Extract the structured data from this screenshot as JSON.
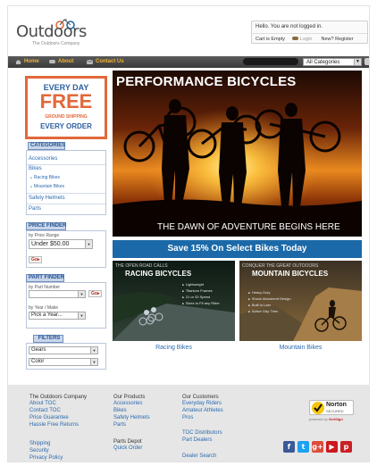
{
  "header": {
    "logo_text": "Outdoors",
    "logo_sub": "The Outdoors Company",
    "account_status": "Hello. You are not logged in.",
    "cart_status": "Cart is Empty",
    "login_label": "Login",
    "register_label": "New? Register"
  },
  "nav": {
    "home": "Home",
    "about": "About",
    "contact": "Contact Us",
    "category_select": "All Categories"
  },
  "promo": {
    "line1": "EVERY DAY",
    "line2": "FREE",
    "line3": "GROUND SHIPPING",
    "line4": "EVERY ORDER"
  },
  "categories": {
    "heading": "CATEGORIES",
    "items": [
      "Accessories",
      "Bikes",
      "Racing Bikes",
      "Mountain Bikes",
      "Safety Helmets",
      "Parts"
    ]
  },
  "price_finder": {
    "heading": "PRICE FINDER",
    "label": "by Price Range",
    "value": "Under $50.00",
    "go": "Go"
  },
  "part_finder": {
    "heading": "PART FINDER",
    "part_label": "by Part Number",
    "part_go": "Go",
    "year_label": "by Year / Make",
    "year_value": "Pick a Year..."
  },
  "filters": {
    "heading": "FILTERS",
    "gears": "Gears",
    "color": "Color"
  },
  "hero": {
    "title": "PERFORMANCE BICYCLES",
    "caption": "THE DAWN OF ADVENTURE BEGINS HERE"
  },
  "save_band": "Save 15% On Select Bikes Today",
  "panels": [
    {
      "kicker": "THE OPEN ROAD CALLS",
      "title": "RACING BICYCLES",
      "features": [
        "Lightweight",
        "Titanium Frames",
        "21 or 33 Speed",
        "Sizes to Fit any Rider"
      ],
      "link": "Racing Bikes"
    },
    {
      "kicker": "CONQUER THE GREAT OUTDOORS",
      "title": "MOUNTAIN BICYCLES",
      "features": [
        "Heavy Duty",
        "Shock Absorbent Design",
        "Built to Last",
        "Active Grip Tires"
      ],
      "link": "Mountain Bikes"
    }
  ],
  "footer": {
    "col1": {
      "heading": "The Outdoors Company",
      "links": [
        "About TOC",
        "Contact TOC",
        "Price Guarantee",
        "Hassle Free Returns"
      ],
      "links2": [
        "Shipping",
        "Security",
        "Privacy Policy"
      ]
    },
    "col2": {
      "heading": "Our Products",
      "links": [
        "Accessories",
        "Bikes",
        "Safety Helmets",
        "Parts"
      ],
      "heading2": "Parts Depot",
      "links2": [
        "Quick Order"
      ]
    },
    "col3": {
      "heading": "Our Customers",
      "links": [
        "Everyday Riders",
        "Amateur Athletes",
        "Pros"
      ],
      "links2": [
        "TOC Distributors",
        "Part Dealers"
      ],
      "links3": [
        "Dealer Search"
      ]
    },
    "norton": {
      "name": "Norton",
      "secured": "SECURED",
      "powered": "powered by",
      "by": "VeriSign"
    },
    "social": [
      {
        "icon": "facebook-icon",
        "glyph": "f",
        "color": "#3b5998"
      },
      {
        "icon": "twitter-icon",
        "glyph": "t",
        "color": "#1da1f2"
      },
      {
        "icon": "google-plus-icon",
        "glyph": "g+",
        "color": "#dd4b39"
      },
      {
        "icon": "youtube-icon",
        "glyph": "▶",
        "color": "#cc181e"
      },
      {
        "icon": "pinterest-icon",
        "glyph": "p",
        "color": "#cb2027"
      }
    ]
  },
  "colors": {
    "nav_text": "#f2b230",
    "link": "#2a6aaf",
    "promo_orange": "#e2683a",
    "save_band": "#1b69a8"
  }
}
